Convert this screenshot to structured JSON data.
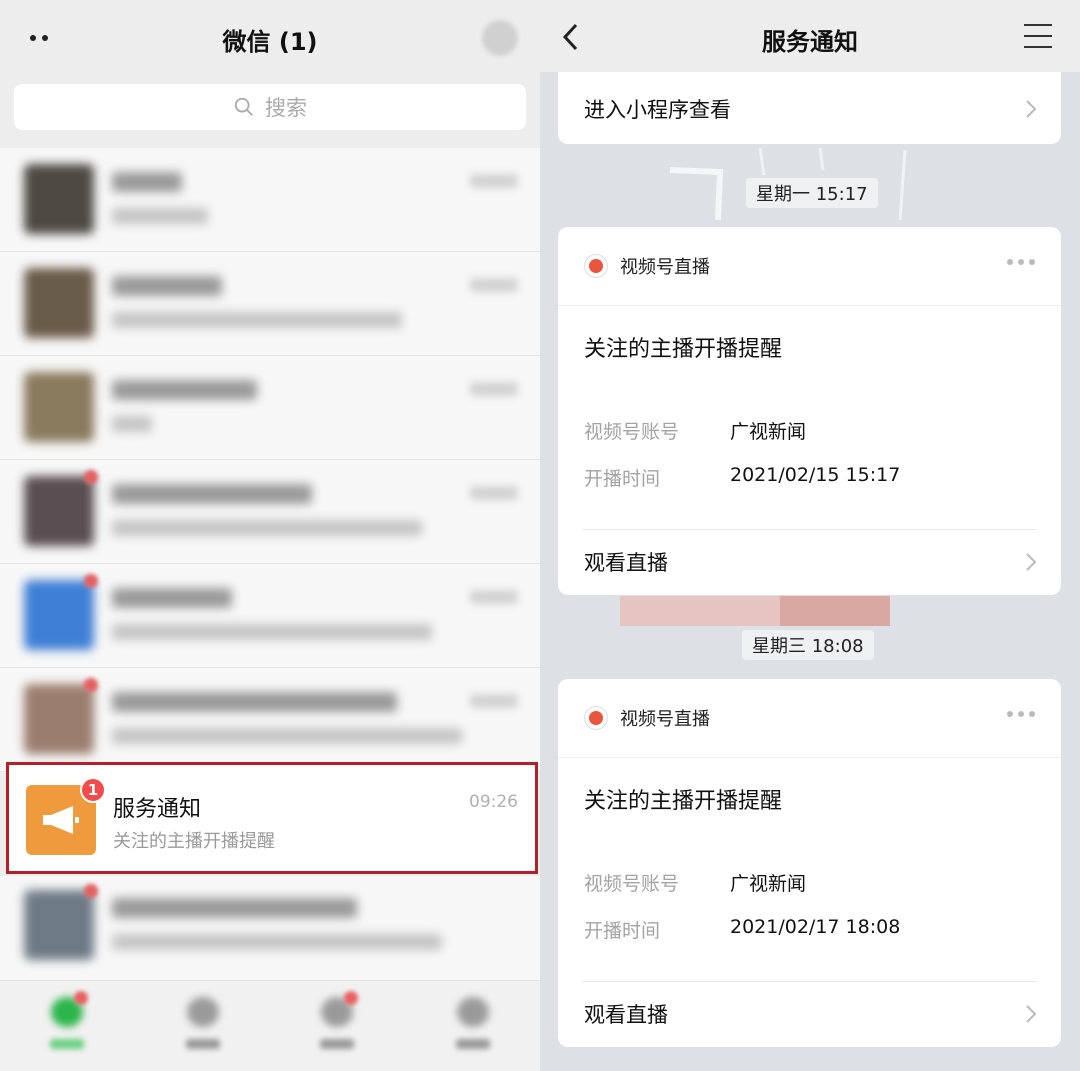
{
  "left": {
    "title": "微信 (1)",
    "search_placeholder": "搜索",
    "highlighted_chat": {
      "name": "服务通知",
      "preview": "关注的主播开播提醒",
      "time": "09:26",
      "badge": "1"
    }
  },
  "right": {
    "title": "服务通知",
    "top_link": "进入小程序查看",
    "messages": [
      {
        "timestamp": "星期一 15:17",
        "source": "视频号直播",
        "title": "关注的主播开播提醒",
        "fields": [
          {
            "key": "视频号账号",
            "value": "广视新闻"
          },
          {
            "key": "开播时间",
            "value": "2021/02/15 15:17"
          }
        ],
        "action": "观看直播"
      },
      {
        "timestamp": "星期三 18:08",
        "source": "视频号直播",
        "title": "关注的主播开播提醒",
        "fields": [
          {
            "key": "视频号账号",
            "value": "广视新闻"
          },
          {
            "key": "开播时间",
            "value": "2021/02/17 18:08"
          }
        ],
        "action": "观看直播"
      }
    ]
  },
  "colors": {
    "highlight_border": "#b3202a",
    "service_icon": "#ef9a3c",
    "badge": "#f04c4c",
    "live_dot": "#e8553d"
  },
  "icons": [
    "more-dots-icon",
    "search-icon",
    "megaphone-icon",
    "back-chevron-icon",
    "menu-icon",
    "chevron-right-icon",
    "live-dot-icon",
    "ellipsis-icon"
  ]
}
